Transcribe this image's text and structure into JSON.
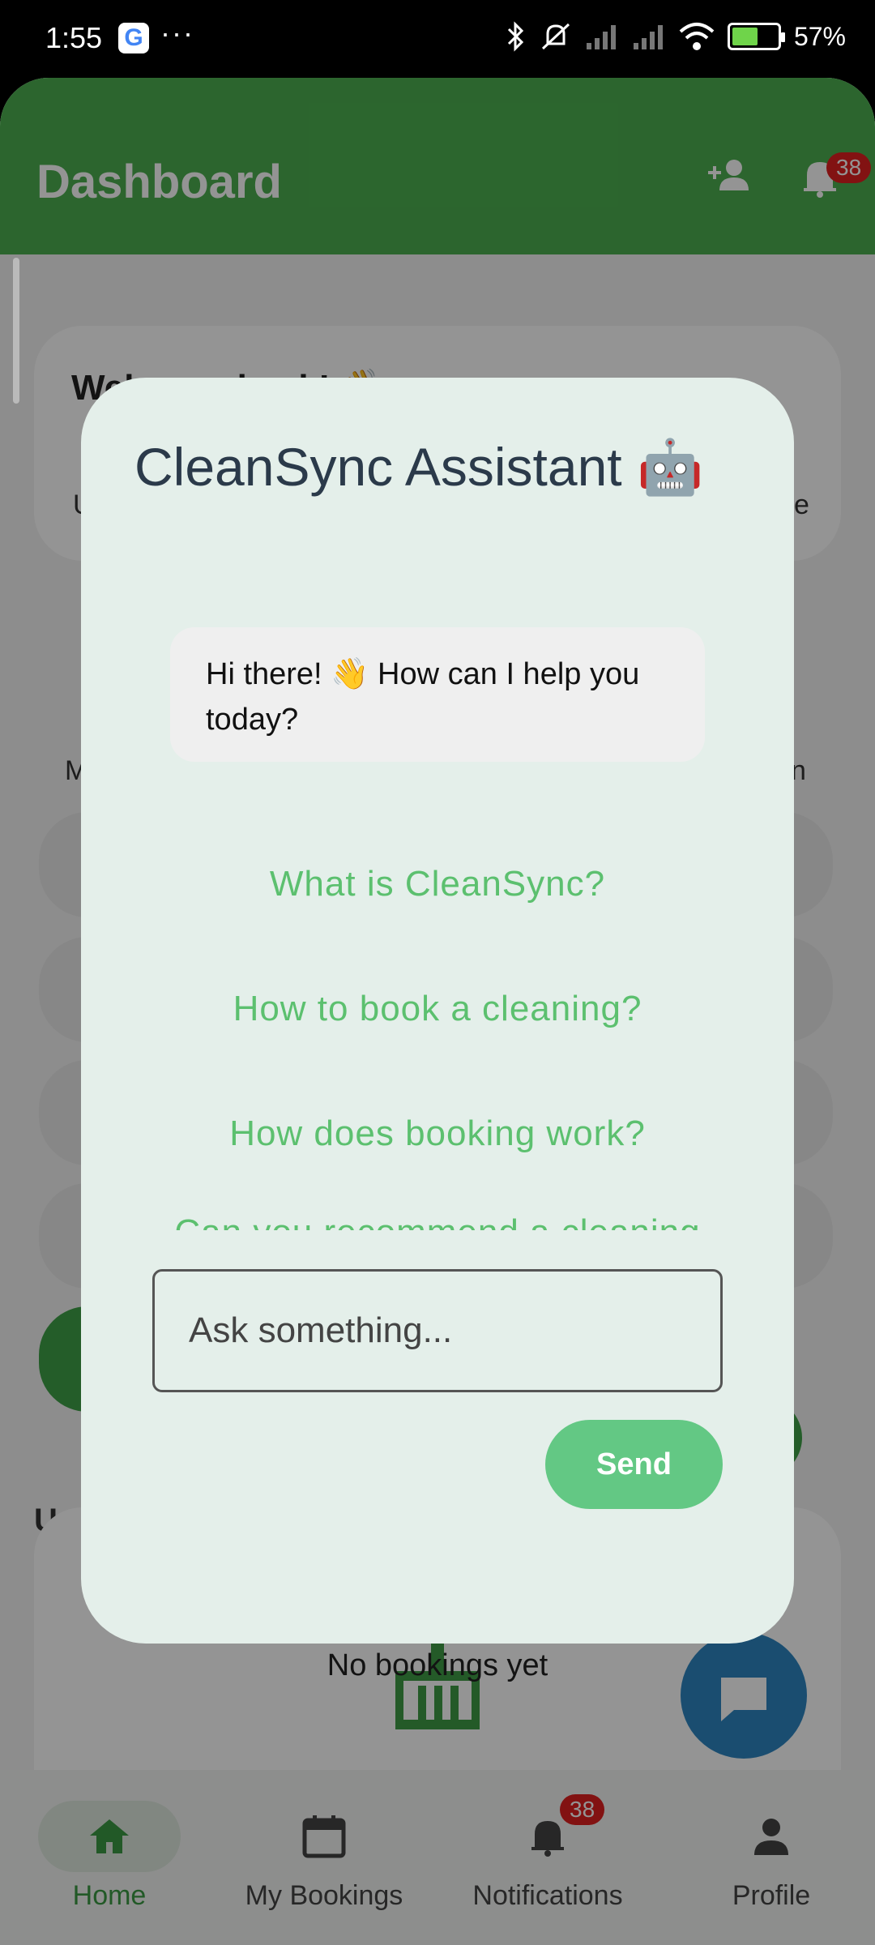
{
  "status_bar": {
    "time": "1:55",
    "google_badge": "G",
    "dots": "···",
    "battery": "57%",
    "battery_level_percent": 57,
    "icons": [
      "bluetooth-icon",
      "silent-icon",
      "signal-icon",
      "signal-icon",
      "wifi-icon",
      "battery-icon"
    ]
  },
  "appbar": {
    "title": "Dashboard",
    "notification_count": "38",
    "icons": [
      "add-person-icon",
      "bell-icon"
    ]
  },
  "background": {
    "welcome": "Welcome back! 👋",
    "row_labels_left": [
      "M",
      "U"
    ],
    "row_labels_right": [
      "n",
      "e"
    ],
    "upcoming_label": "Up",
    "no_bookings": "No bookings yet"
  },
  "bottom_nav": {
    "items": [
      {
        "label": "Home",
        "icon": "home-icon",
        "active": true
      },
      {
        "label": "My Bookings",
        "icon": "calendar-icon",
        "active": false
      },
      {
        "label": "Notifications",
        "icon": "bell-icon",
        "active": false,
        "badge": "38"
      },
      {
        "label": "Profile",
        "icon": "person-icon",
        "active": false
      }
    ]
  },
  "dialog": {
    "title": "CleanSync Assistant 🤖",
    "greeting": "Hi there! 👋 How can I help you today?",
    "suggestions": [
      "What is CleanSync?",
      "How to book a cleaning?",
      "How does booking work?",
      "Can you recommend a cleaning"
    ],
    "input_placeholder": "Ask something...",
    "send_label": "Send"
  },
  "colors": {
    "appbar": "#4caf50",
    "accent": "#63c884",
    "dialog_bg": "#e4efea",
    "suggestion": "#5cc06f",
    "badge": "#e02020"
  }
}
